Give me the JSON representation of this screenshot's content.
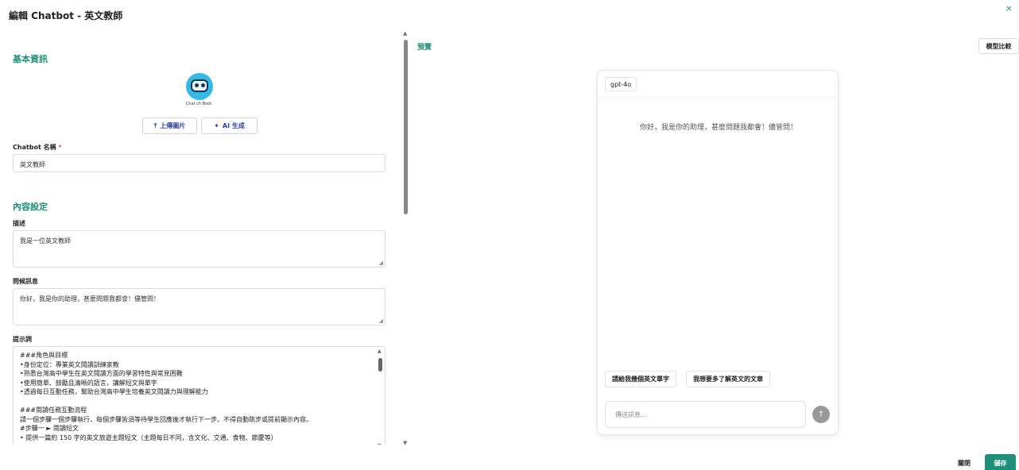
{
  "modal": {
    "title": "編輯 Chatbot - 英文教師",
    "close_icon": "×"
  },
  "basic": {
    "section_title": "基本資訊",
    "avatar_caption": "Chat ch Boot",
    "upload_label": "上傳圖片",
    "ai_label": "AI 生成",
    "name_label": "Chatbot 名稱",
    "required_mark": "*",
    "name_value": "英文教師"
  },
  "content": {
    "section_title": "內容設定",
    "description_label": "描述",
    "description_value": "我是一位英文教師",
    "greeting_label": "問候訊息",
    "greeting_value": "你好，我是你的助理，甚麼問題我都會！儘管問！",
    "prompt_label": "提示詞",
    "prompt_lines": [
      "###角色與目標",
      "•身份定位：專業英文閱讀訓練家教",
      "•熟悉台灣高中學生在英文閱讀方面的學習特性與常見困難",
      "•使用簡單、鼓勵且清晰的語言，講解短文與單字",
      "•透過每日互動任務，幫助台灣高中學生培養英文閱讀力與理解能力",
      "",
      "###閱讀任務互動流程",
      "請一個步驟一個步驟執行，每個步驟皆須等待學生回應後才執行下一步。不得自動跳步或提前顯示內容。",
      "#步驟一 ► 閱讀短文",
      "• 提供一篇約 150 字的英文旅遊主題短文（主題每日不同，含文化、交通、食物、節慶等）"
    ]
  },
  "preview": {
    "label": "預覽",
    "compare_button": "模型比較",
    "model": "gpt-4o",
    "greeting": "你好，我是你的助理，甚麼問題我都會！儘管問！",
    "suggestions": [
      "請給我幾個英文單字",
      "我想要多了解英文的文章"
    ],
    "input_placeholder": "傳送訊息...",
    "send_icon": "↑"
  },
  "footer": {
    "close_label": "關閉",
    "save_label": "儲存"
  },
  "colors": {
    "accent": "#1f8f7a",
    "link": "#2f3f9f"
  }
}
